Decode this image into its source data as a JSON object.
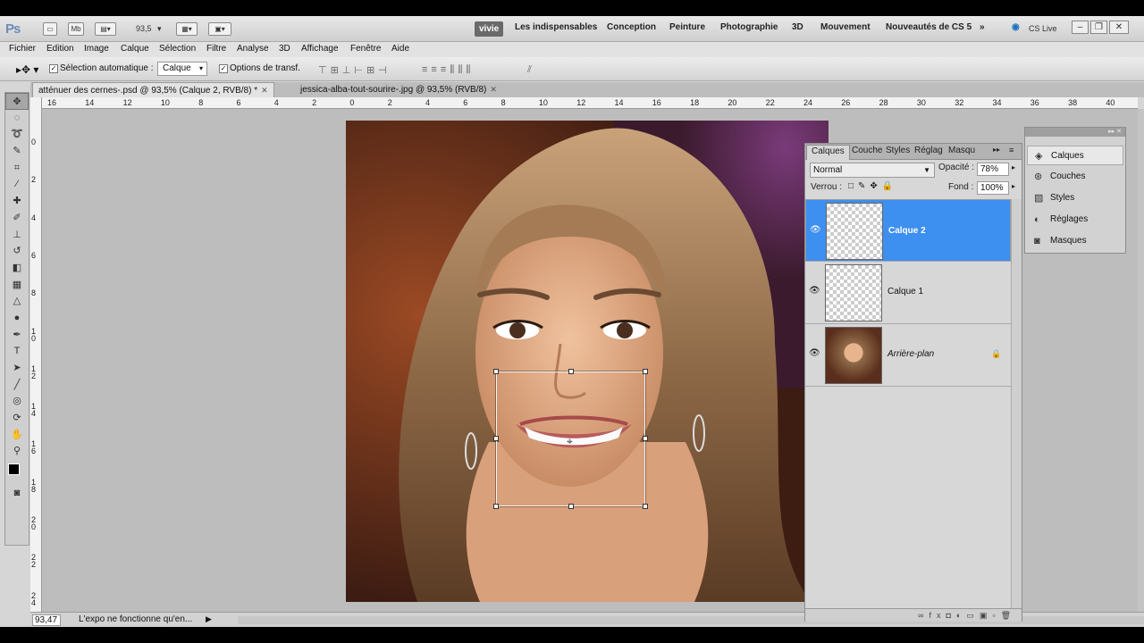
{
  "app": {
    "logo": "Ps"
  },
  "topbar": {
    "zoom": "93,5",
    "workspaces": [
      "vivie",
      "Les indispensables",
      "Conception",
      "Peinture",
      "Photographie",
      "3D",
      "Mouvement",
      "Nouveautés de CS 5"
    ],
    "cs_live": "CS Live"
  },
  "menu": [
    "Fichier",
    "Edition",
    "Image",
    "Calque",
    "Sélection",
    "Filtre",
    "Analyse",
    "3D",
    "Affichage",
    "Fenêtre",
    "Aide"
  ],
  "options": {
    "auto_select_label": "Sélection automatique :",
    "auto_select_value": "Calque",
    "transform_label": "Options de transf."
  },
  "documents": [
    {
      "title": "atténuer des cernes-.psd @ 93,5% (Calque 2, RVB/8) *",
      "close": "✕"
    },
    {
      "title": "jessica-alba-tout-sourire-.jpg @ 93,5% (RVB/8)",
      "close": "✕"
    }
  ],
  "ruler": {
    "h": [
      "16",
      "14",
      "12",
      "10",
      "8",
      "6",
      "4",
      "2",
      "0",
      "2",
      "4",
      "6",
      "8",
      "10",
      "12",
      "14",
      "16",
      "18",
      "20",
      "22",
      "24",
      "26",
      "28",
      "30",
      "32",
      "34",
      "36",
      "38",
      "40"
    ],
    "v": [
      "0",
      "2",
      "4",
      "6",
      "8",
      "1 0",
      "1 2",
      "1 4",
      "1 6",
      "1 8",
      "2 0",
      "2 2",
      "2 4",
      "2 6"
    ]
  },
  "status": {
    "zoom": "93,47",
    "message": "L'expo ne fonctionne qu'en..."
  },
  "layers_panel": {
    "tabs": [
      "Calques",
      "Couche",
      "Styles",
      "Réglag",
      "Masqu"
    ],
    "blend_mode": "Normal",
    "opacity_label": "Opacité :",
    "opacity_value": "78%",
    "lock_label": "Verrou :",
    "fill_label": "Fond :",
    "fill_value": "100%",
    "layers": [
      {
        "name": "Calque 2",
        "selected": true
      },
      {
        "name": "Calque 1",
        "selected": false
      },
      {
        "name": "Arrière-plan",
        "selected": false
      }
    ]
  },
  "side_panel": {
    "items": [
      "Calques",
      "Couches",
      "Styles",
      "Réglages",
      "Masques"
    ]
  }
}
